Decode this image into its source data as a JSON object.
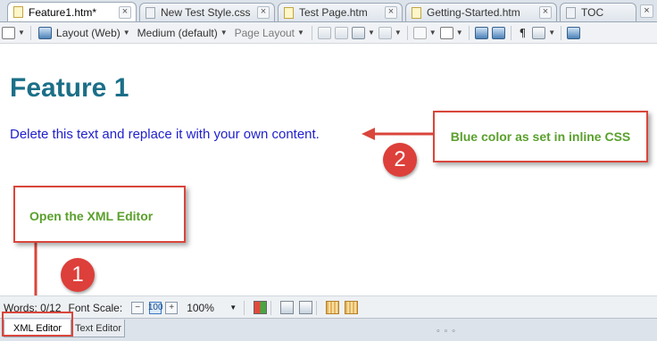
{
  "tabs": [
    {
      "label": "Feature1.htm*",
      "kind": "htm",
      "active": true
    },
    {
      "label": "New Test Style.css",
      "kind": "css",
      "active": false
    },
    {
      "label": "Test Page.htm",
      "kind": "htm",
      "active": false
    },
    {
      "label": "Getting-Started.htm",
      "kind": "htm",
      "active": false
    },
    {
      "label": "TOC",
      "kind": "css",
      "active": false
    }
  ],
  "toolbar": {
    "layout_dropdown": "Layout (Web)",
    "medium_dropdown": "Medium (default)",
    "page_layout_dropdown": "Page Layout",
    "pilcrow": "¶"
  },
  "document": {
    "heading": "Feature 1",
    "paragraph": "Delete this text and replace it with your own content.",
    "paragraph_color": "#1f1fcf",
    "heading_color": "#1b6f88"
  },
  "annotations": {
    "css_callout": "Blue color as set in inline CSS",
    "xml_callout": "Open the XML Editor",
    "badge_1": "1",
    "badge_2": "2",
    "callout_color": "#d9463b",
    "callout_text_color": "#5aa02c"
  },
  "statusbar": {
    "words_label": "Words: 0/12",
    "font_scale_label": "Font Scale:",
    "minus": "−",
    "reset": "100",
    "plus": "+",
    "zoom": "100%"
  },
  "bottom_tabs": {
    "xml_editor": "XML Editor",
    "text_editor": "Text Editor",
    "grip": "∘∘∘"
  }
}
